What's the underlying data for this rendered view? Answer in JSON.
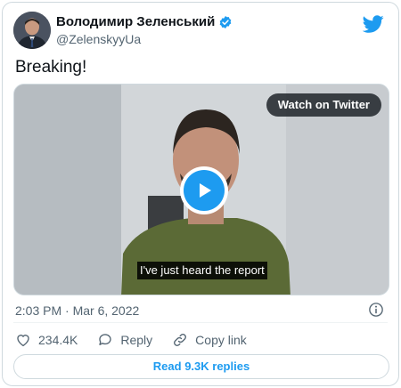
{
  "author": {
    "display_name": "Володимир Зеленський",
    "handle": "@ZelenskyyUa",
    "verified": true
  },
  "tweet": {
    "text": "Breaking!",
    "timestamp": "2:03 PM · Mar 6, 2022"
  },
  "media": {
    "watch_label": "Watch on Twitter",
    "caption": "I've just heard the report"
  },
  "actions": {
    "likes": "234.4K",
    "reply_label": "Reply",
    "copy_link_label": "Copy link"
  },
  "replies_button": "Read 9.3K replies",
  "colors": {
    "accent": "#1d9bf0",
    "muted_text": "#536471",
    "border": "#cfd9de"
  },
  "icons": [
    "twitter-bird-icon",
    "verified-badge-icon",
    "play-icon",
    "info-icon",
    "heart-icon",
    "reply-icon",
    "link-icon"
  ]
}
